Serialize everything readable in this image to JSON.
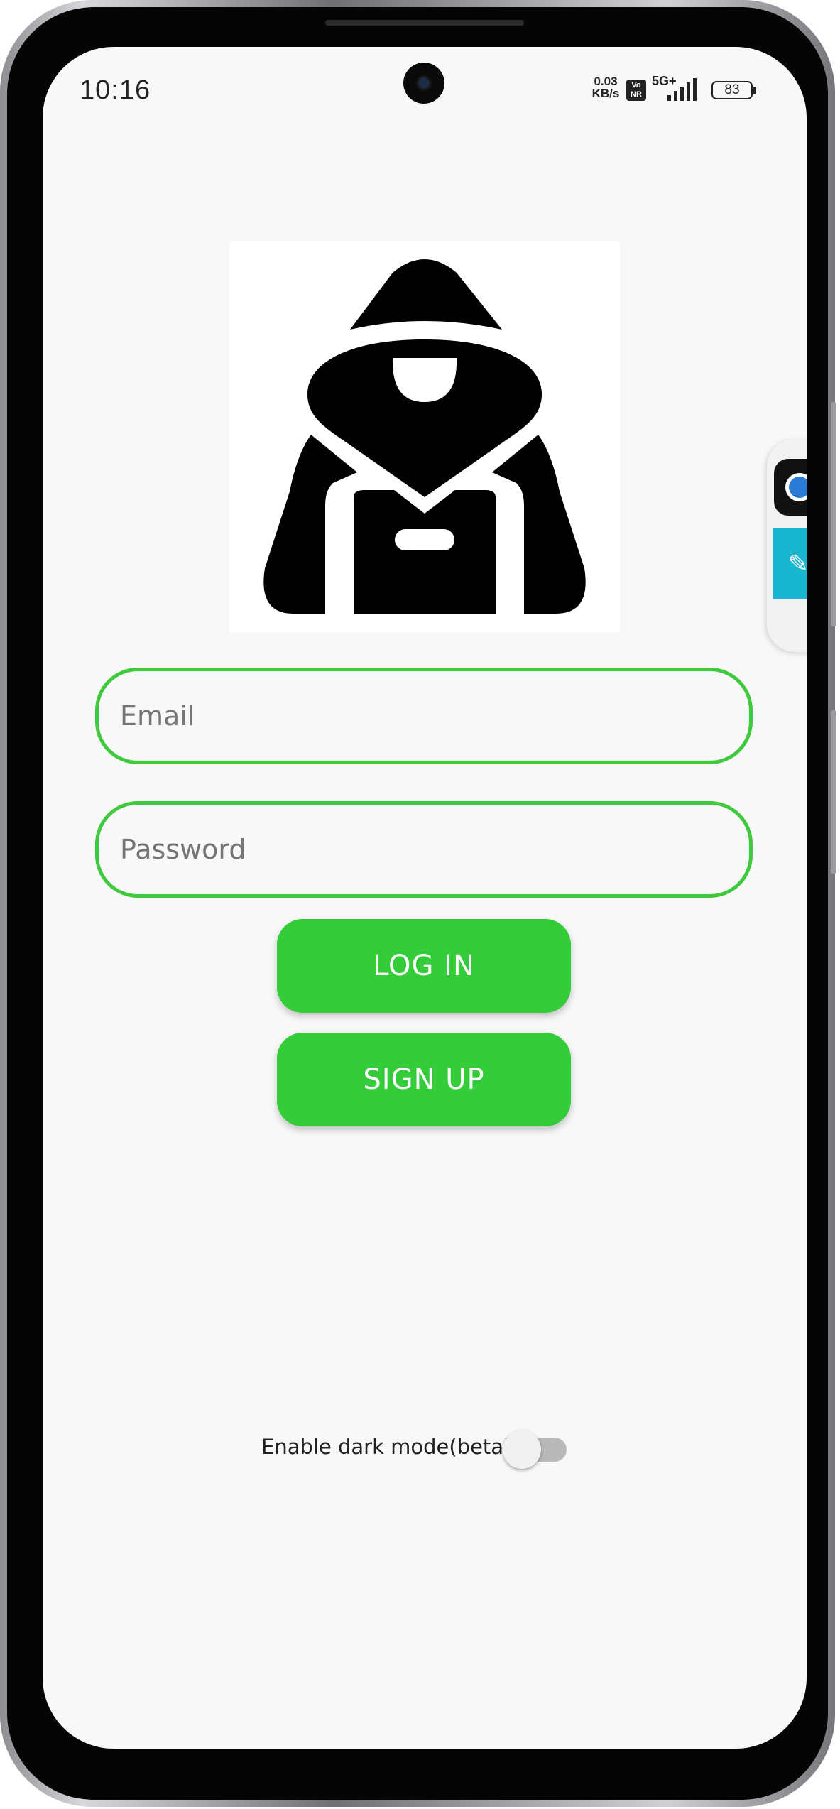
{
  "status_bar": {
    "time": "10:16",
    "net_speed_value": "0.03",
    "net_speed_unit": "KB/s",
    "volte_top": "Vo",
    "volte_bottom": "NR",
    "network_type": "5G+",
    "battery_level": "83"
  },
  "login_form": {
    "email_placeholder": "Email",
    "password_placeholder": "Password",
    "login_label": "LOG IN",
    "signup_label": "SIGN UP"
  },
  "settings": {
    "dark_mode_label": "Enable dark mode(beta)",
    "dark_mode_enabled": false
  },
  "colors": {
    "accent_green": "#34cc39",
    "field_border": "#3fc93c",
    "background": "#f8f8f8"
  },
  "icons": {
    "logo": "hooded-hacker-icon",
    "floating_tool_top": "globe-app-icon",
    "floating_tool_bottom": "pencil-icon"
  }
}
